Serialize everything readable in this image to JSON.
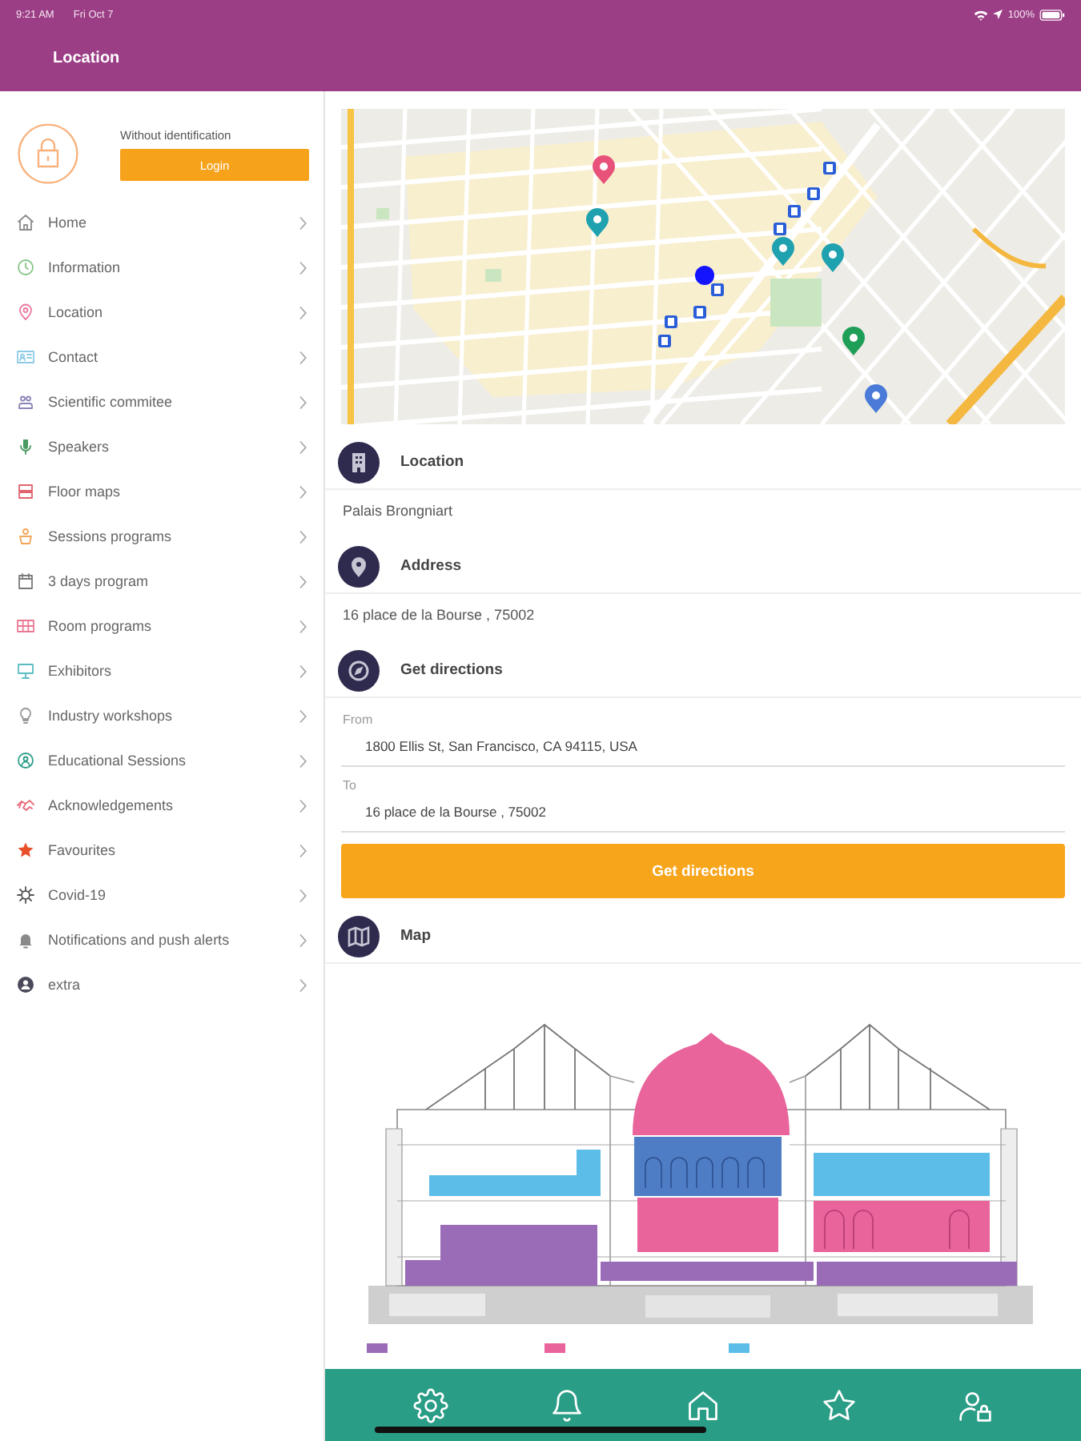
{
  "status_bar": {
    "time": "9:21 AM",
    "date": "Fri Oct 7",
    "battery": "100%"
  },
  "header": {
    "title": "Location"
  },
  "sidebar": {
    "profile": {
      "status": "Without identification",
      "login_button": "Login"
    },
    "items": [
      {
        "label": "Home",
        "color": "#8c8c8c"
      },
      {
        "label": "Information",
        "color": "#86c587"
      },
      {
        "label": "Location",
        "color": "#e9789c"
      },
      {
        "label": "Contact",
        "color": "#8ccbe6"
      },
      {
        "label": "Scientific commitee",
        "color": "#8b86b8"
      },
      {
        "label": "Speakers",
        "color": "#4a9a62"
      },
      {
        "label": "Floor maps",
        "color": "#e0636e"
      },
      {
        "label": "Sessions programs",
        "color": "#f2a65a"
      },
      {
        "label": "3 days program",
        "color": "#7a7a7a"
      },
      {
        "label": "Room programs",
        "color": "#ea7a94"
      },
      {
        "label": "Exhibitors",
        "color": "#5bbcc0"
      },
      {
        "label": "Industry workshops",
        "color": "#9a9a9a"
      },
      {
        "label": "Educational Sessions",
        "color": "#2f9e8a"
      },
      {
        "label": "Acknowledgements",
        "color": "#ea6a7a"
      },
      {
        "label": "Favourites",
        "color": "#e8502a"
      },
      {
        "label": "Covid-19",
        "color": "#555555"
      },
      {
        "label": "Notifications and push alerts",
        "color": "#8a8a8a"
      },
      {
        "label": "extra",
        "color": "#4a4a5a"
      }
    ]
  },
  "sections": [
    {
      "kind": "info",
      "title": "Location",
      "value": "Palais Brongniart"
    },
    {
      "kind": "info",
      "title": "Address",
      "value": "16 place de la Bourse , 75002"
    },
    {
      "kind": "directions",
      "title": "Get directions",
      "fields": [
        {
          "label": "From",
          "value": "1800 Ellis St, San Francisco, CA 94115, USA"
        },
        {
          "label": "To",
          "value": "16 place de la Bourse , 75002"
        }
      ],
      "button": "Get directions"
    },
    {
      "kind": "floor_map",
      "title": "Map"
    }
  ]
}
